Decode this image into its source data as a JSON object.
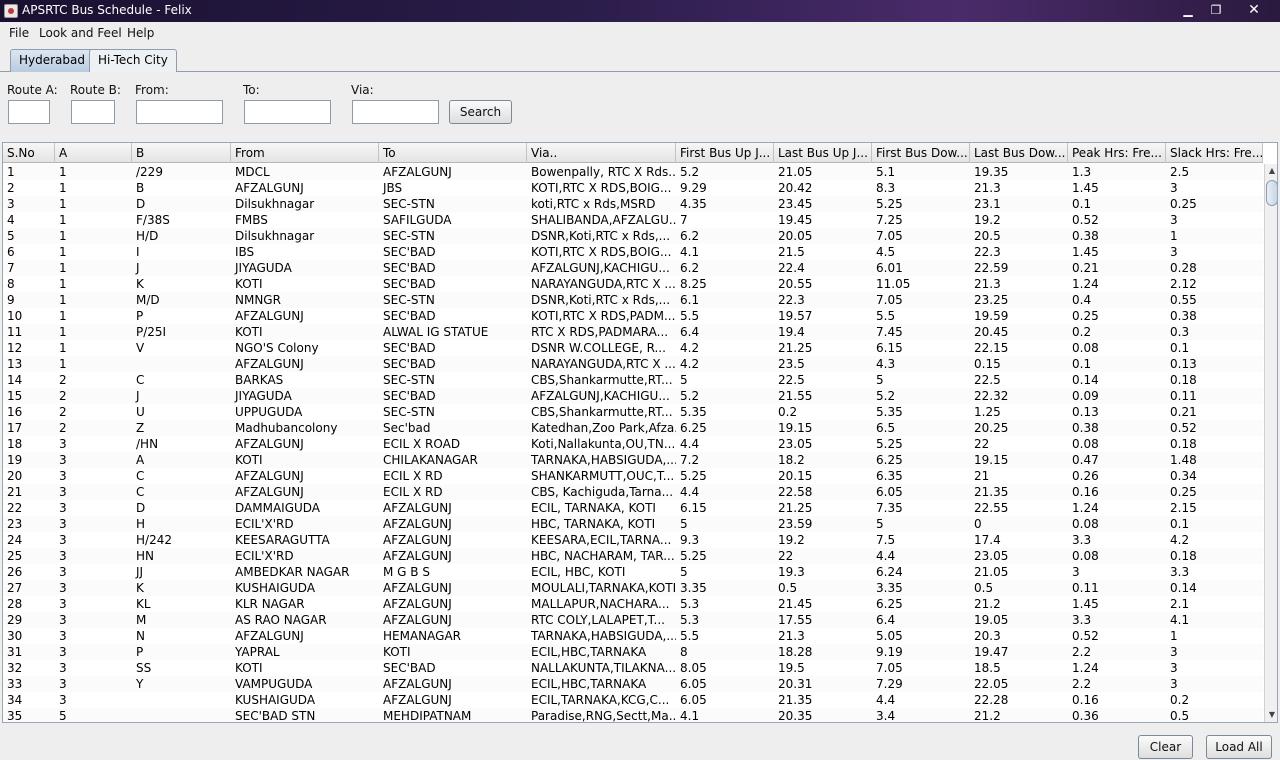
{
  "window": {
    "title": "APSRTC Bus Schedule - Felix",
    "minimize": "▁",
    "maximize": "❐",
    "close": "✕"
  },
  "menu": {
    "file": "File",
    "look_and_feel": "Look and Feel",
    "help": "Help"
  },
  "tabs": [
    {
      "label": "Hyderabad",
      "active": true
    },
    {
      "label": "Hi-Tech City",
      "active": false
    }
  ],
  "search": {
    "route_a_label": "Route A:",
    "route_b_label": "Route B:",
    "from_label": "From:",
    "to_label": "To:",
    "via_label": "Via:",
    "route_a_value": "",
    "route_b_value": "",
    "from_value": "",
    "to_value": "",
    "via_value": "",
    "search_button": "Search"
  },
  "table": {
    "columns": [
      "S.No",
      "A",
      "B",
      "From",
      "To",
      "Via..",
      "First Bus Up J...",
      "Last Bus Up J...",
      "First Bus Dow...",
      "Last Bus Dow...",
      "Peak Hrs: Fre...",
      "Slack Hrs: Fre..."
    ],
    "rows": [
      [
        "1",
        "1",
        "/229",
        "MDCL",
        "AFZALGUNJ",
        "Bowenpally, RTC X Rds...",
        "5.2",
        "21.05",
        "5.1",
        "19.35",
        "1.3",
        "2.5"
      ],
      [
        "2",
        "1",
        "B",
        "AFZALGUNJ",
        "JBS",
        "KOTI,RTC X RDS,BOIG...",
        "9.29",
        "20.42",
        "8.3",
        "21.3",
        "1.45",
        "3"
      ],
      [
        "3",
        "1",
        "D",
        "Dilsukhnagar",
        "SEC-STN",
        "koti,RTC x Rds,MSRD",
        "4.35",
        "23.45",
        "5.25",
        "23.1",
        "0.1",
        "0.25"
      ],
      [
        "4",
        "1",
        "F/38S",
        "FMBS",
        "SAFILGUDA",
        "SHALIBANDA,AFZALGU...",
        "7",
        "19.45",
        "7.25",
        "19.2",
        "0.52",
        "3"
      ],
      [
        "5",
        "1",
        "H/D",
        "Dilsukhnagar",
        "SEC-STN",
        "DSNR,Koti,RTC x Rds,...",
        "6.2",
        "20.05",
        "7.05",
        "20.5",
        "0.38",
        "1"
      ],
      [
        "6",
        "1",
        "I",
        "IBS",
        "SEC'BAD",
        "KOTI,RTC X RDS,BOIG...",
        "4.1",
        "21.5",
        "4.5",
        "22.3",
        "1.45",
        "3"
      ],
      [
        "7",
        "1",
        "J",
        "JIYAGUDA",
        "SEC'BAD",
        "AFZALGUNJ,KACHIGU...",
        "6.2",
        "22.4",
        "6.01",
        "22.59",
        "0.21",
        "0.28"
      ],
      [
        "8",
        "1",
        "K",
        "KOTI",
        "SEC'BAD",
        "NARAYANGUDA,RTC X ...",
        "8.25",
        "20.55",
        "11.05",
        "21.3",
        "1.24",
        "2.12"
      ],
      [
        "9",
        "1",
        "M/D",
        "NMNGR",
        "SEC-STN",
        "DSNR,Koti,RTC x Rds,...",
        "6.1",
        "22.3",
        "7.05",
        "23.25",
        "0.4",
        "0.55"
      ],
      [
        "10",
        "1",
        "P",
        "AFZALGUNJ",
        "SEC'BAD",
        "KOTI,RTC X RDS,PADM...",
        "5.5",
        "19.57",
        "5.5",
        "19.59",
        "0.25",
        "0.38"
      ],
      [
        "11",
        "1",
        "P/25I",
        "KOTI",
        "ALWAL IG STATUE",
        "RTC X RDS,PADMARA...",
        "6.4",
        "19.4",
        "7.45",
        "20.45",
        "0.2",
        "0.3"
      ],
      [
        "12",
        "1",
        "V",
        "NGO'S Colony",
        "SEC'BAD",
        "DSNR W.COLLEGE, R...",
        "4.2",
        "21.25",
        "6.15",
        "22.15",
        "0.08",
        "0.1"
      ],
      [
        "13",
        "1",
        "",
        "AFZALGUNJ",
        "SEC'BAD",
        "NARAYANGUDA,RTC X ...",
        "4.2",
        "23.5",
        "4.3",
        "0.15",
        "0.1",
        "0.13"
      ],
      [
        "14",
        "2",
        "C",
        "BARKAS",
        "SEC-STN",
        "CBS,Shankarmutte,RT...",
        "5",
        "22.5",
        "5",
        "22.5",
        "0.14",
        "0.18"
      ],
      [
        "15",
        "2",
        "J",
        "JIYAGUDA",
        "SEC'BAD",
        "AFZALGUNJ,KACHIGU...",
        "5.2",
        "21.55",
        "5.2",
        "22.32",
        "0.09",
        "0.11"
      ],
      [
        "16",
        "2",
        "U",
        "UPPUGUDA",
        "SEC-STN",
        "CBS,Shankarmutte,RT...",
        "5.35",
        "0.2",
        "5.35",
        "1.25",
        "0.13",
        "0.21"
      ],
      [
        "17",
        "2",
        "Z",
        "Madhubancolony",
        "Sec'bad",
        "Katedhan,Zoo Park,Afza...",
        "6.25",
        "19.15",
        "6.5",
        "20.25",
        "0.38",
        "0.52"
      ],
      [
        "18",
        "3",
        "/HN",
        "AFZALGUNJ",
        "ECIL X ROAD",
        "Koti,Nallakunta,OU,TN...",
        "4.4",
        "23.05",
        "5.25",
        "22",
        "0.08",
        "0.18"
      ],
      [
        "19",
        "3",
        "A",
        "KOTI",
        "CHILAKANAGAR",
        "TARNAKA,HABSIGUDA,...",
        "7.2",
        "18.2",
        "6.25",
        "19.15",
        "0.47",
        "1.48"
      ],
      [
        "20",
        "3",
        "C",
        "AFZALGUNJ",
        "ECIL X RD",
        "SHANKARMUTT,OUC,T...",
        "5.25",
        "20.15",
        "6.35",
        "21",
        "0.26",
        "0.34"
      ],
      [
        "21",
        "3",
        "C",
        "AFZALGUNJ",
        "ECIL X RD",
        "CBS, Kachiguda,Tarna...",
        "4.4",
        "22.58",
        "6.05",
        "21.35",
        "0.16",
        "0.25"
      ],
      [
        "22",
        "3",
        "D",
        "DAMMAIGUDA",
        "AFZALGUNJ",
        "ECIL, TARNAKA, KOTI",
        "6.15",
        "21.25",
        "7.35",
        "22.55",
        "1.24",
        "2.15"
      ],
      [
        "23",
        "3",
        "H",
        "ECIL'X'RD",
        "AFZALGUNJ",
        "HBC, TARNAKA, KOTI",
        "5",
        "23.59",
        "5",
        "0",
        "0.08",
        "0.1"
      ],
      [
        "24",
        "3",
        "H/242",
        "KEESARAGUTTA",
        "AFZALGUNJ",
        "KEESARA,ECIL,TARNA...",
        "9.3",
        "19.2",
        "7.5",
        "17.4",
        "3.3",
        "4.2"
      ],
      [
        "25",
        "3",
        "HN",
        "ECIL'X'RD",
        "AFZALGUNJ",
        "HBC, NACHARAM, TAR...",
        "5.25",
        "22",
        "4.4",
        "23.05",
        "0.08",
        "0.18"
      ],
      [
        "26",
        "3",
        "JJ",
        "AMBEDKAR NAGAR",
        "M G B S",
        "ECIL, HBC, KOTI",
        "5",
        "19.3",
        "6.24",
        "21.05",
        "3",
        "3.3"
      ],
      [
        "27",
        "3",
        "K",
        "KUSHAIGUDA",
        "AFZALGUNJ",
        "MOULALI,TARNAKA,KOTI",
        "3.35",
        "0.5",
        "3.35",
        "0.5",
        "0.11",
        "0.14"
      ],
      [
        "28",
        "3",
        "KL",
        "KLR NAGAR",
        "AFZALGUNJ",
        "MALLAPUR,NACHARA...",
        "5.3",
        "21.45",
        "6.25",
        "21.2",
        "1.45",
        "2.1"
      ],
      [
        "29",
        "3",
        "M",
        "AS RAO NAGAR",
        "AFZALGUNJ",
        "RTC COLY,LALAPET,T...",
        "5.3",
        "17.55",
        "6.4",
        "19.05",
        "3.3",
        "4.1"
      ],
      [
        "30",
        "3",
        "N",
        "AFZALGUNJ",
        "HEMANAGAR",
        "TARNAKA,HABSIGUDA,...",
        "5.5",
        "21.3",
        "5.05",
        "20.3",
        "0.52",
        "1"
      ],
      [
        "31",
        "3",
        "P",
        "YAPRAL",
        "KOTI",
        "ECIL,HBC,TARNAKA",
        "8",
        "18.28",
        "9.19",
        "19.47",
        "2.2",
        "3"
      ],
      [
        "32",
        "3",
        "SS",
        "KOTI",
        "SEC'BAD",
        "NALLAKUNTA,TILAKNA...",
        "8.05",
        "19.5",
        "7.05",
        "18.5",
        "1.24",
        "3"
      ],
      [
        "33",
        "3",
        "Y",
        "VAMPUGUDA",
        "AFZALGUNJ",
        "ECIL,HBC,TARNAKA",
        "6.05",
        "20.31",
        "7.29",
        "22.05",
        "2.2",
        "3"
      ],
      [
        "34",
        "3",
        "",
        "KUSHAIGUDA",
        "AFZALGUNJ",
        "ECIL,TARNAKA,KCG,C...",
        "6.05",
        "21.35",
        "4.4",
        "22.28",
        "0.16",
        "0.2"
      ],
      [
        "35",
        "5",
        "",
        "SEC'BAD STN",
        "MEHDIPATNAM",
        "Paradise,RNG,Sectt,Ma...",
        "4.1",
        "20.35",
        "3.4",
        "21.2",
        "0.36",
        "0.5"
      ]
    ]
  },
  "scrollbar": {
    "up": "▲",
    "down": "▼"
  },
  "footer": {
    "clear_button": "Clear",
    "load_all_button": "Load All"
  }
}
